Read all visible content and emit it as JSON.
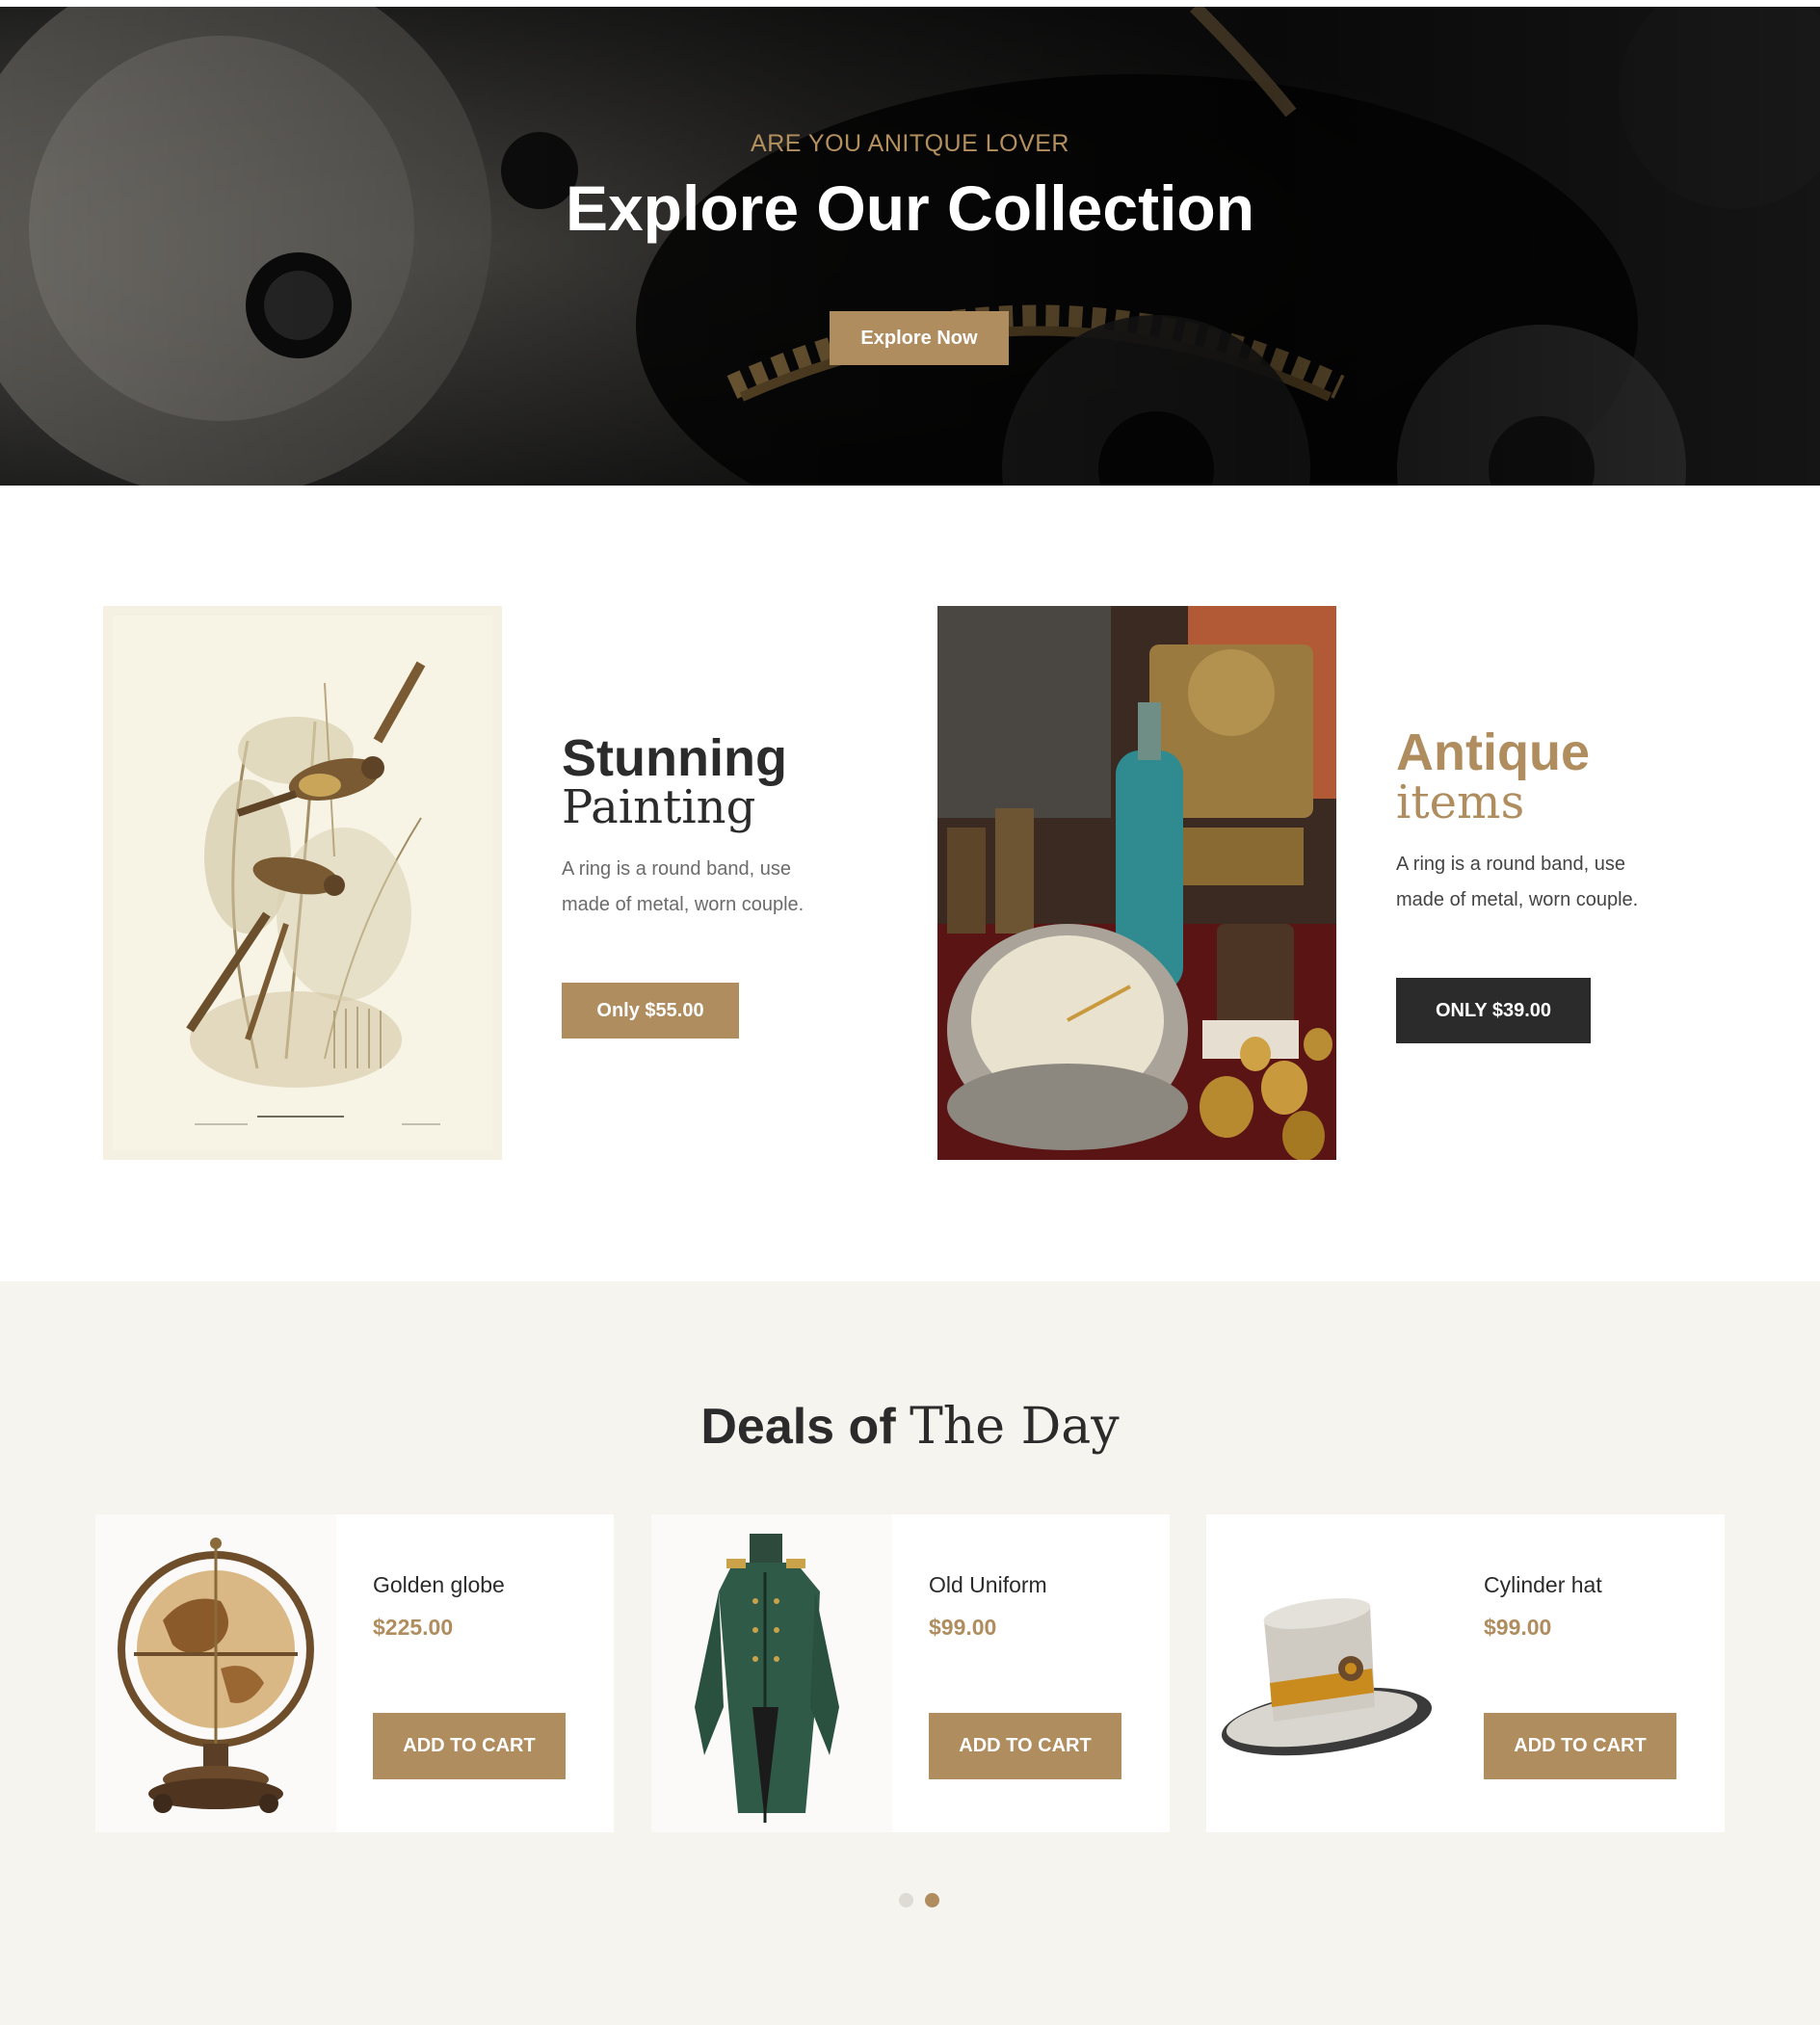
{
  "hero": {
    "eyebrow": "ARE YOU ANITQUE LOVER",
    "title": "Explore Our Collection",
    "button": "Explore Now"
  },
  "promos": [
    {
      "title_bold": "Stunning",
      "title_serif": "Painting",
      "description": "A ring is a round band, use made of metal, worn couple.",
      "button": "Only $55.00",
      "image_icon": "bird-painting-image"
    },
    {
      "title_bold": "Antique",
      "title_serif": "items",
      "description": "A ring is a round band, use made of metal, worn couple.",
      "button": "ONLY $39.00",
      "image_icon": "antique-items-image"
    }
  ],
  "deals": {
    "title_bold": "Deals of",
    "title_serif": "The Day",
    "products": [
      {
        "name": "Golden globe",
        "price": "$225.00",
        "button": "ADD TO CART",
        "image_icon": "globe-image"
      },
      {
        "name": "Old Uniform",
        "price": "$99.00",
        "button": "ADD TO CART",
        "image_icon": "coat-image"
      },
      {
        "name": "Cylinder hat",
        "price": "$99.00",
        "button": "ADD TO CART",
        "image_icon": "top-hat-image"
      }
    ],
    "pagination": {
      "pages": 2,
      "active": 2
    }
  },
  "colors": {
    "accent": "#b08d5f",
    "dark": "#2b2b2b",
    "deals_bg": "#f6f4ef",
    "dot_inactive": "#dedad4"
  }
}
